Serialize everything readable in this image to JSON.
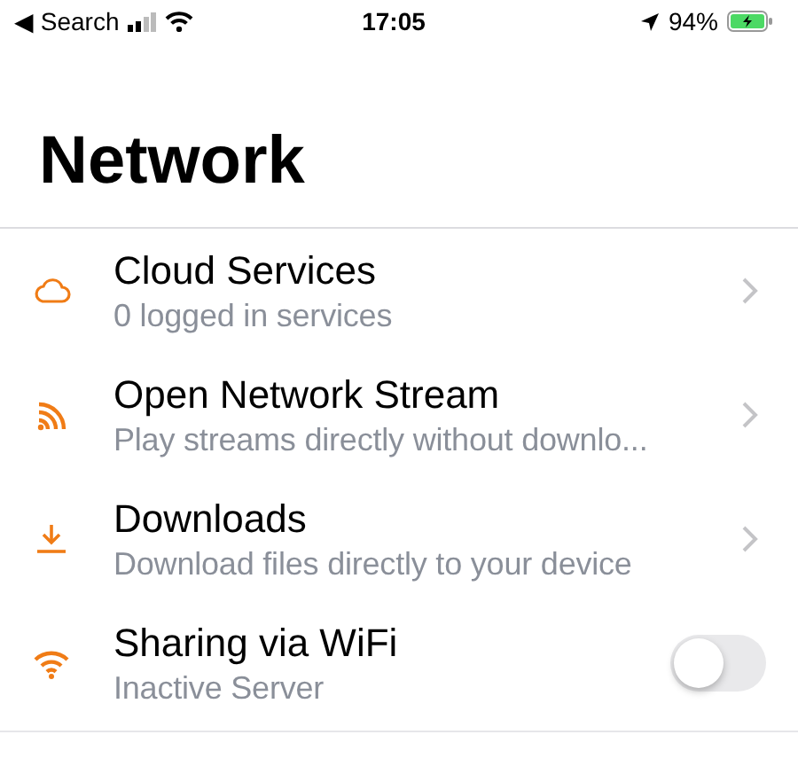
{
  "status_bar": {
    "back": "◀ Search",
    "time": "17:05",
    "battery": "94%"
  },
  "title": "Network",
  "items": [
    {
      "kind": "link",
      "title": "Cloud Services",
      "subtitle": "0 logged in services"
    },
    {
      "kind": "link",
      "title": "Open Network Stream",
      "subtitle": "Play streams directly without downlo..."
    },
    {
      "kind": "link",
      "title": "Downloads",
      "subtitle": "Download files directly to your device"
    },
    {
      "kind": "toggle",
      "title": "Sharing via WiFi",
      "subtitle": "Inactive Server",
      "on": false
    }
  ]
}
